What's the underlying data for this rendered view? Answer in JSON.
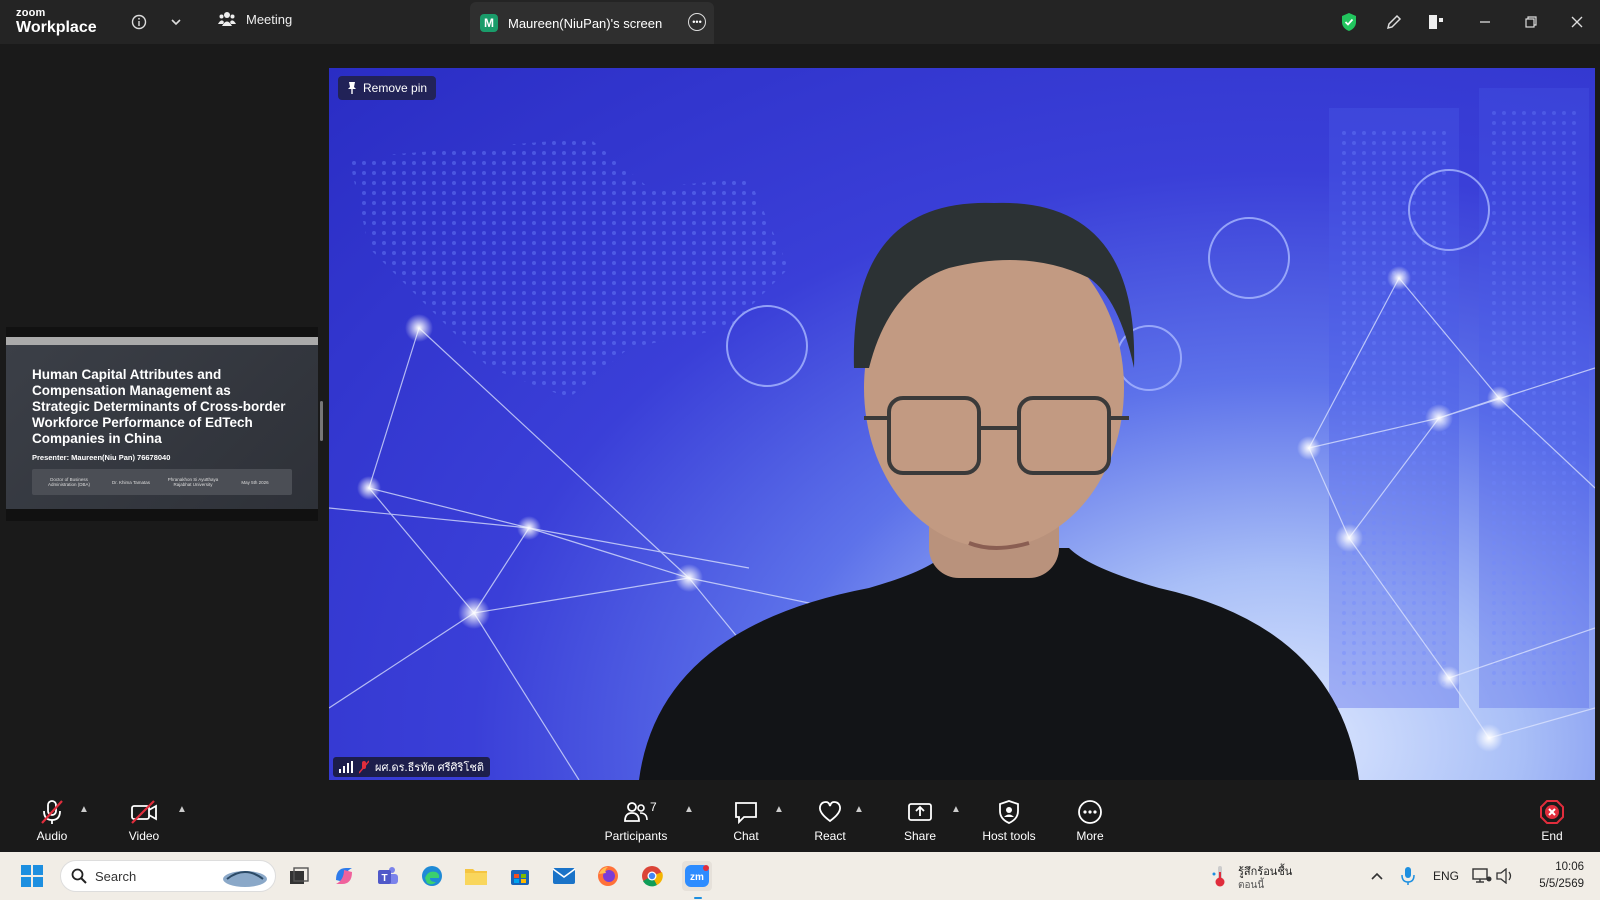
{
  "app": {
    "logo_small": "zoom",
    "logo_big": "Workplace",
    "meeting_tab_label": "Meeting",
    "screen_tab_badge": "M",
    "screen_tab_label": "Maureen(NiuPan)'s screen"
  },
  "slide": {
    "title": "Human Capital Attributes and Compensation Management as Strategic Determinants of Cross-border Workforce Performance of EdTech Companies in China",
    "presenter": "Presenter: Maureen(Niu Pan) 76678040",
    "meta": [
      "Doctor of Business Administration (DBA)",
      "Dr. Khima Tamatas",
      "Phranakhon Si Ayutthaya Rajabhat University",
      "May 5th 2026"
    ]
  },
  "video": {
    "pin_label": "Remove pin",
    "participant_name": "ผศ.ดร.ธีรทัต ศรีศิริโชติ"
  },
  "toolbar": {
    "audio": "Audio",
    "video": "Video",
    "participants": "Participants",
    "participants_count": "7",
    "chat": "Chat",
    "react": "React",
    "share": "Share",
    "host_tools": "Host tools",
    "more": "More",
    "end": "End"
  },
  "taskbar": {
    "search_placeholder": "Search",
    "weather_line1": "รู้สึกร้อนชื้น",
    "weather_line2": "ตอนนี้",
    "language": "ENG",
    "time": "10:06",
    "date": "5/5/2569"
  },
  "colors": {
    "accent_green": "#1a9c6a",
    "shield_green": "#22c55e",
    "end_red": "#e02d3c",
    "muted_red": "#e02d3c"
  }
}
